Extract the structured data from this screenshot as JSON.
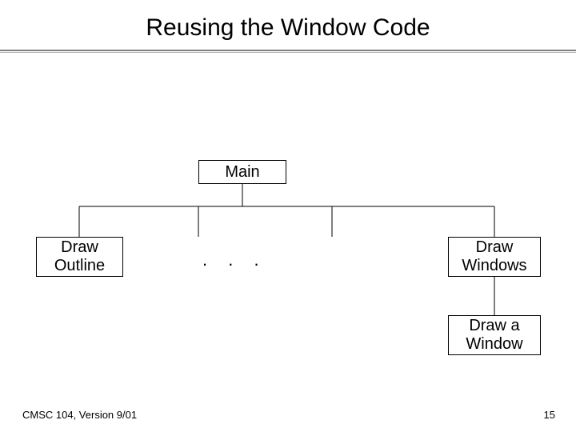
{
  "slide": {
    "title": "Reusing the Window Code",
    "footer_left": "CMSC 104, Version 9/01",
    "page_number": "15"
  },
  "diagram": {
    "root": "Main",
    "ellipsis": ".  .  .",
    "children": {
      "left": "Draw\nOutline",
      "right": "Draw\nWindows",
      "grandchild": "Draw a\nWindow"
    }
  },
  "chart_data": {
    "type": "diagram",
    "title": "Reusing the Window Code",
    "structure": "hierarchy",
    "nodes": [
      {
        "id": "main",
        "label": "Main"
      },
      {
        "id": "draw_outline",
        "label": "Draw Outline",
        "parent": "main"
      },
      {
        "id": "ellipsis",
        "label": ". . .",
        "parent": "main",
        "placeholder": true
      },
      {
        "id": "draw_windows",
        "label": "Draw Windows",
        "parent": "main"
      },
      {
        "id": "draw_a_window",
        "label": "Draw a Window",
        "parent": "draw_windows"
      }
    ],
    "edges": [
      {
        "from": "main",
        "to": "draw_outline"
      },
      {
        "from": "main",
        "to": "ellipsis"
      },
      {
        "from": "main",
        "to": "draw_windows"
      },
      {
        "from": "draw_windows",
        "to": "draw_a_window"
      }
    ]
  }
}
